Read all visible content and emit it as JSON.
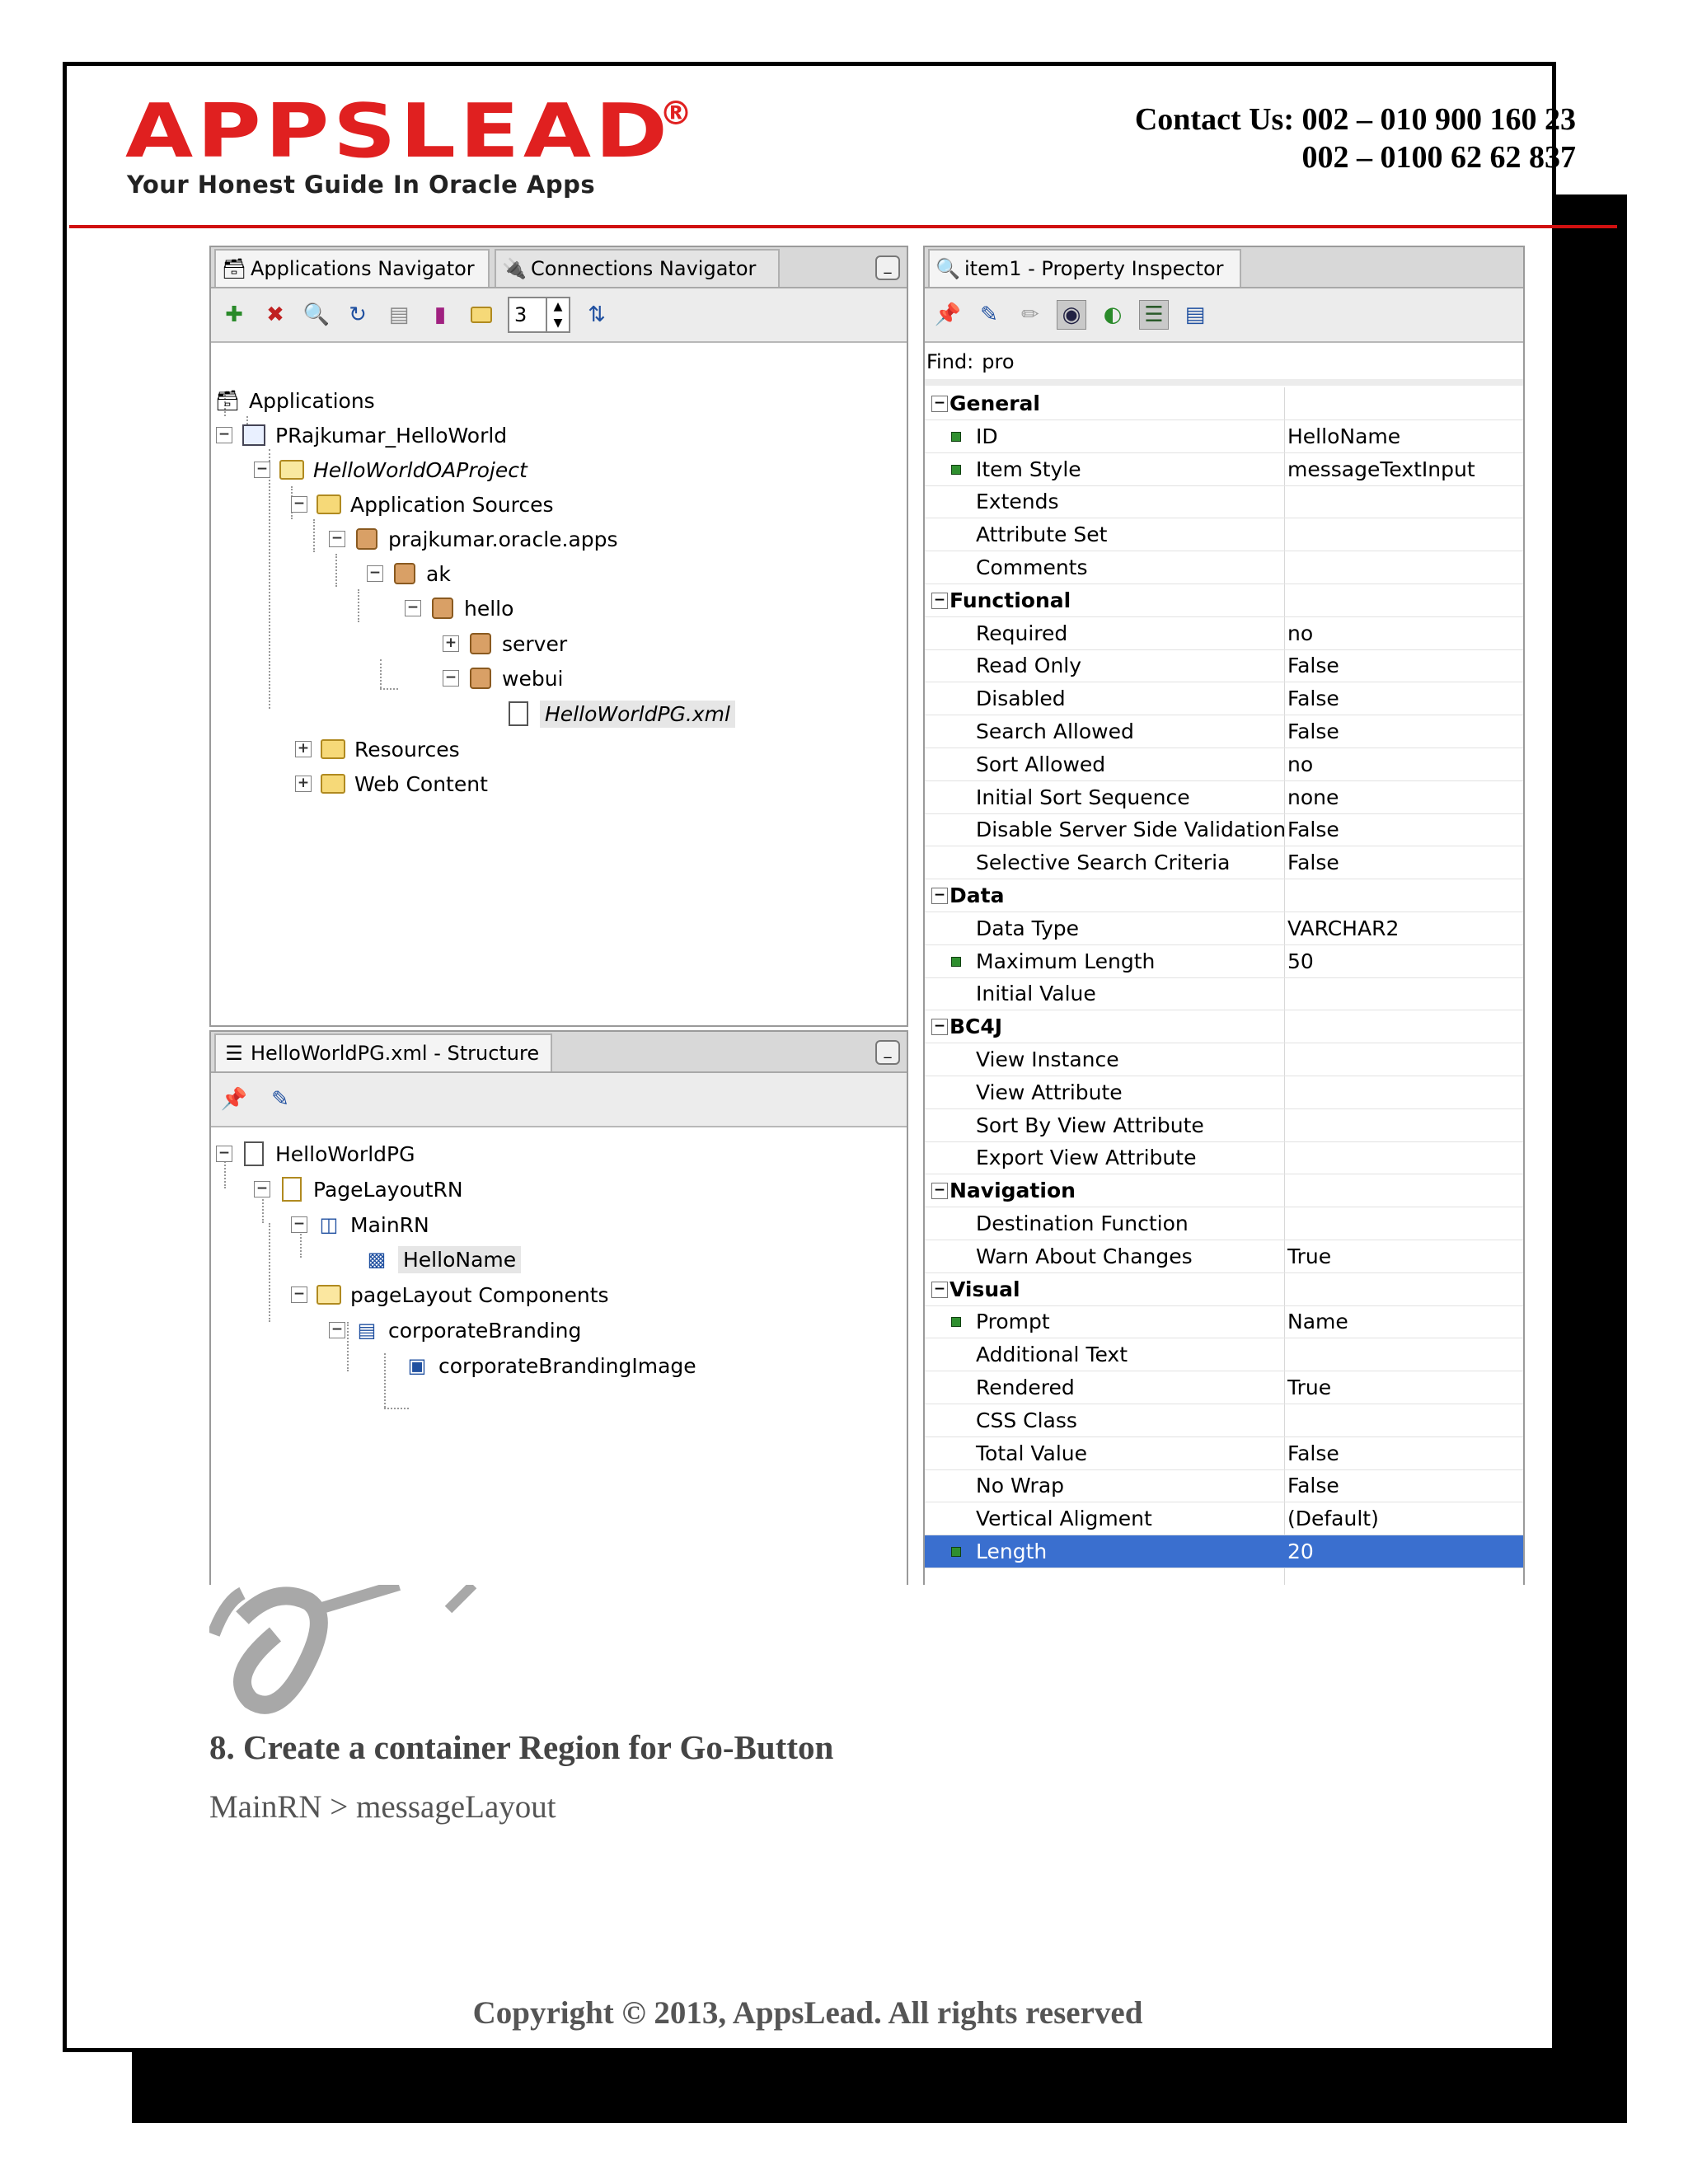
{
  "header": {
    "logo_text": "APPSLEAD",
    "logo_registered": "®",
    "tagline": "Your Honest Guide In Oracle Apps",
    "contact_line1": "Contact Us: 002 – 010 900 160 23",
    "contact_line2": "002 – 0100 62 62 837",
    "brand_color": "#e02020"
  },
  "navigator": {
    "tab_applications": "Applications Navigator",
    "tab_connections": "Connections Navigator",
    "spinner_value": "3",
    "tree": [
      {
        "label": "Applications"
      },
      {
        "label": "PRajkumar_HelloWorld"
      },
      {
        "label": "HelloWorldOAProject"
      },
      {
        "label": "Application Sources"
      },
      {
        "label": "prajkumar.oracle.apps"
      },
      {
        "label": "ak"
      },
      {
        "label": "hello"
      },
      {
        "label": "server"
      },
      {
        "label": "webui"
      },
      {
        "label": "HelloWorldPG.xml"
      },
      {
        "label": "Resources"
      },
      {
        "label": "Web Content"
      }
    ]
  },
  "structure": {
    "tab_title": "HelloWorldPG.xml - Structure",
    "tree": [
      {
        "label": "HelloWorldPG"
      },
      {
        "label": "PageLayoutRN"
      },
      {
        "label": "MainRN"
      },
      {
        "label": "HelloName"
      },
      {
        "label": "pageLayout Components"
      },
      {
        "label": "corporateBranding"
      },
      {
        "label": "corporateBrandingImage"
      }
    ]
  },
  "inspector": {
    "tab_title": "item1 - Property Inspector",
    "find_label": "Find:",
    "find_value": "pro",
    "rows": [
      {
        "name": "General",
        "value": ""
      },
      {
        "name": "ID",
        "value": "HelloName"
      },
      {
        "name": "Item Style",
        "value": "messageTextInput"
      },
      {
        "name": "Extends",
        "value": ""
      },
      {
        "name": "Attribute Set",
        "value": ""
      },
      {
        "name": "Comments",
        "value": ""
      },
      {
        "name": "Functional",
        "value": ""
      },
      {
        "name": "Required",
        "value": "no"
      },
      {
        "name": "Read Only",
        "value": "False"
      },
      {
        "name": "Disabled",
        "value": "False"
      },
      {
        "name": "Search Allowed",
        "value": "False"
      },
      {
        "name": "Sort Allowed",
        "value": "no"
      },
      {
        "name": "Initial Sort Sequence",
        "value": "none"
      },
      {
        "name": "Disable Server Side Validation",
        "value": "False"
      },
      {
        "name": "Selective Search Criteria",
        "value": "False"
      },
      {
        "name": "Data",
        "value": ""
      },
      {
        "name": "Data Type",
        "value": "VARCHAR2"
      },
      {
        "name": "Maximum Length",
        "value": "50"
      },
      {
        "name": "Initial Value",
        "value": ""
      },
      {
        "name": "BC4J",
        "value": ""
      },
      {
        "name": "View Instance",
        "value": ""
      },
      {
        "name": "View Attribute",
        "value": ""
      },
      {
        "name": "Sort By View Attribute",
        "value": ""
      },
      {
        "name": "Export View Attribute",
        "value": ""
      },
      {
        "name": "Navigation",
        "value": ""
      },
      {
        "name": "Destination Function",
        "value": ""
      },
      {
        "name": "Warn About Changes",
        "value": "True"
      },
      {
        "name": "Visual",
        "value": ""
      },
      {
        "name": "Prompt",
        "value": "Name"
      },
      {
        "name": "Additional Text",
        "value": ""
      },
      {
        "name": "Rendered",
        "value": "True"
      },
      {
        "name": "CSS Class",
        "value": ""
      },
      {
        "name": "Total Value",
        "value": "False"
      },
      {
        "name": "No Wrap",
        "value": "False"
      },
      {
        "name": "Vertical Aligment",
        "value": "(Default)"
      },
      {
        "name": "Length",
        "value": "20"
      }
    ]
  },
  "content": {
    "step_title": "8. Create a container Region for Go-Button",
    "step_path": "MainRN > messageLayout"
  },
  "footer": {
    "copyright": "Copyright © 2013, AppsLead. All rights reserved"
  }
}
